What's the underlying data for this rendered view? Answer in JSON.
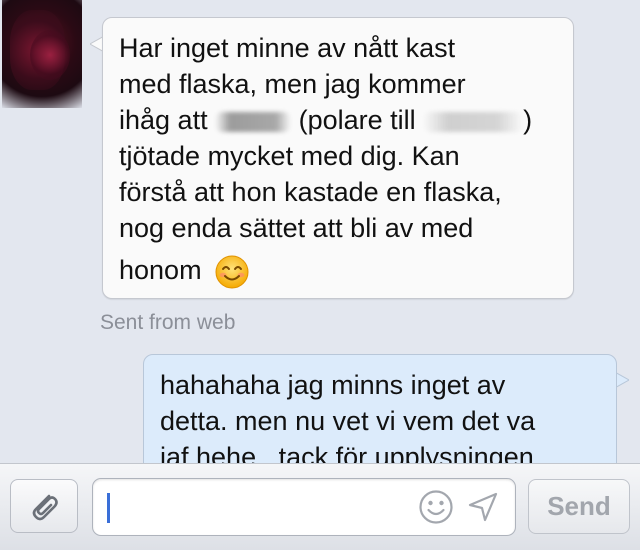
{
  "conversation": {
    "incoming": {
      "line1": "Har inget minne av nått kast",
      "line2": "med flaska, men jag kommer",
      "line3_a": "ihåg att",
      "line3_b": "(polare till",
      "line3_c": ")",
      "line4": "tjötade mycket med dig. Kan",
      "line5": "förstå att hon kastade en flaska,",
      "line6": "nog enda sättet att bli av med",
      "line7": "honom",
      "emoji": "smiling-face-icon"
    },
    "sent_from": "Sent from web",
    "outgoing": {
      "line1": "hahahaha jag minns inget av",
      "line2": "detta. men nu vet vi vem det va",
      "line3": "iaf hehe.. tack för upplysningen"
    }
  },
  "composer": {
    "attach_icon": "paperclip-icon",
    "message_value": "",
    "emoji_icon": "smiley-icon",
    "location_icon": "location-arrow-icon",
    "send_label": "Send"
  },
  "colors": {
    "background": "#e3e7ef",
    "incoming_bubble": "#fafafa",
    "outgoing_bubble": "#dcebfb",
    "caret": "#3a6fd8",
    "send_disabled_text": "#a2a6ad"
  }
}
